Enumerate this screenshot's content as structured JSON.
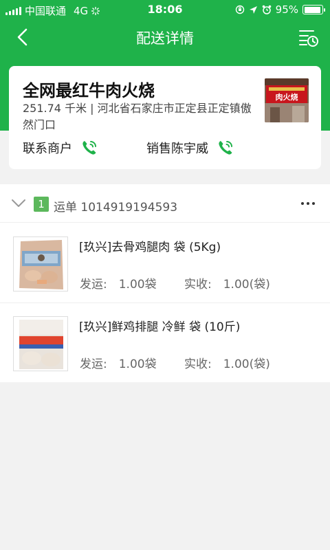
{
  "status_bar": {
    "carrier": "中国联通",
    "network": "4G",
    "time": "18:06",
    "battery": "95%"
  },
  "nav": {
    "title": "配送详情"
  },
  "merchant": {
    "name": "全网最红牛肉火烧",
    "address": "251.74 千米 | 河北省石家庄市正定县正定镇傲然门口",
    "contact_label": "联系商户",
    "sales_label": "销售陈宇威",
    "photo_sign_text": "肉火烧"
  },
  "waybill": {
    "index": "1",
    "label": "运单 1014919194593",
    "items": [
      {
        "name": "[玖兴]去骨鸡腿肉 袋 (5Kg)",
        "shipped": "发运:　1.00袋",
        "received": "实收:　1.00(袋)"
      },
      {
        "name": "[玖兴]鲜鸡排腿 冷鲜 袋 (10斤)",
        "shipped": "发运:　1.00袋",
        "received": "实收:　1.00(袋)"
      }
    ]
  },
  "colors": {
    "brand_green": "#1fb24a",
    "badge_green": "#5cb85c"
  }
}
